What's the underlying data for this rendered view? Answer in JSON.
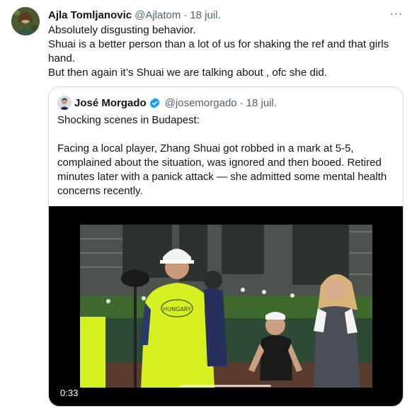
{
  "tweet": {
    "author_name": "Ajla Tomljanovic",
    "author_handle": "@Ajlatom",
    "separator": "·",
    "date": "18 juil.",
    "more_label": "···",
    "lines": [
      "Absolutely disgusting behavior.",
      "Shuai is a better person than a lot of us for shaking the ref and that girls hand.",
      "But then again it’s Shuai we are talking about , ofc she did."
    ]
  },
  "quote": {
    "author_name": "José Morgado",
    "author_handle": "@josemorgado",
    "separator": "·",
    "date": "18 juil.",
    "verified": true,
    "paragraphs": [
      "Shocking scenes in Budapest:",
      "Facing a local player, Zhang Shuai got robbed in a mark at 5-5, complained about the situation, was ignored and then booed. Retired minutes later with a panick attack — she admitted some mental health concerns recently."
    ],
    "video": {
      "duration": "0:33",
      "shirt_text": "HUNGARY"
    }
  },
  "colors": {
    "text": "#0f1419",
    "secondary": "#536471",
    "border": "#cfd9de",
    "verified": "#1d9bf0",
    "vest": "#d6f021"
  }
}
